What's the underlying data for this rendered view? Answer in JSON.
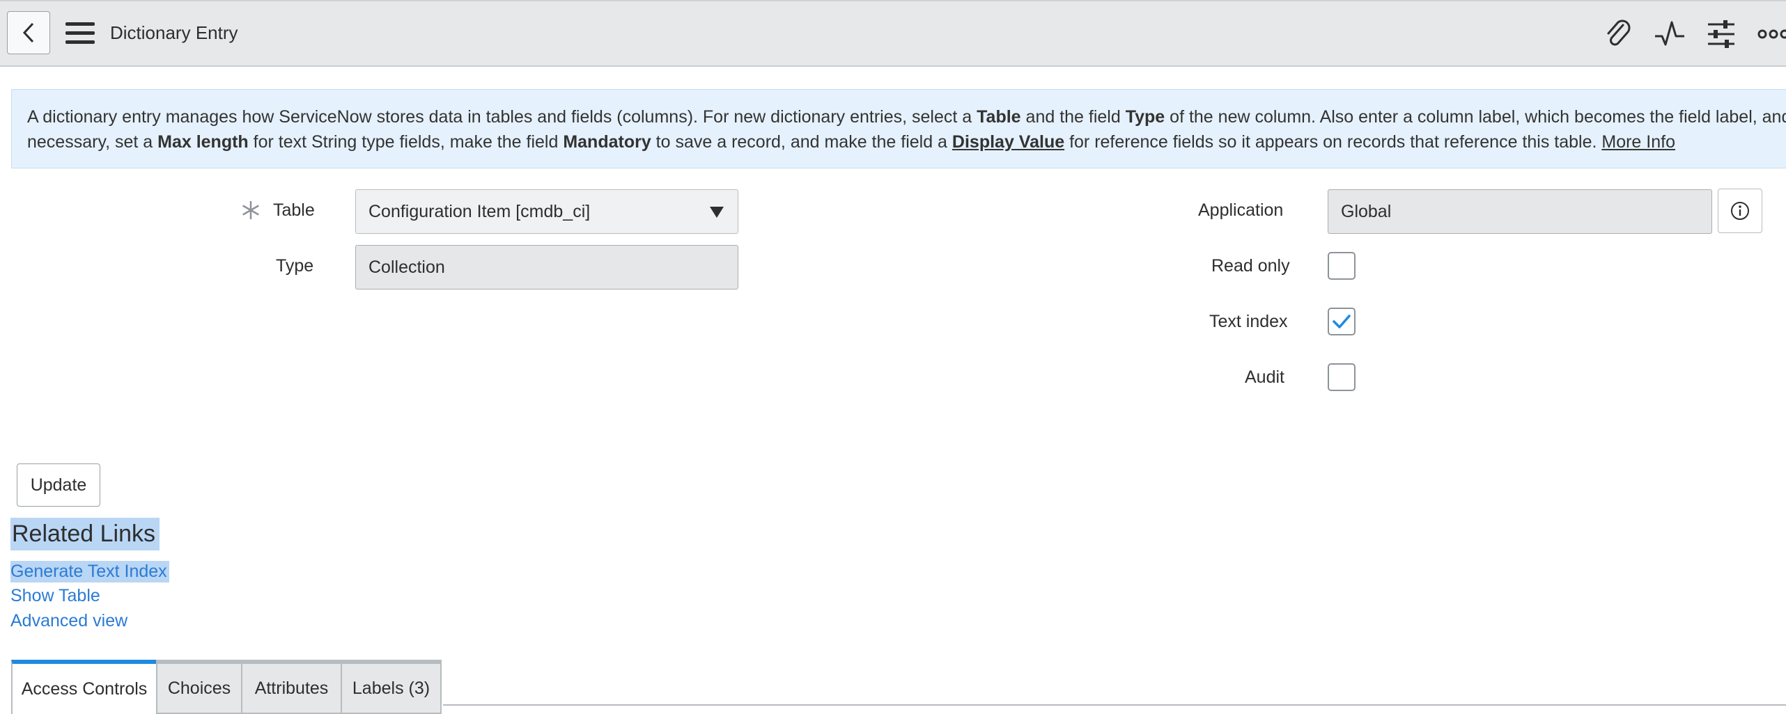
{
  "header": {
    "title": "Dictionary Entry",
    "icons": [
      "back-icon",
      "hamburger-menu-icon",
      "paperclip-icon",
      "activity-icon",
      "settings-sliders-icon",
      "more-icon"
    ]
  },
  "banner": {
    "p1": "A dictionary entry manages how ServiceNow stores data in tables and fields (columns). For new dictionary entries, select a ",
    "table": "Table",
    "p2": " and the field ",
    "type": "Type",
    "p3": " of the new column. Also enter a column label, which becomes the field label, and the co",
    "p4": "necessary, set a ",
    "max_length": "Max length",
    "p5": " for text String type fields, make the field ",
    "mandatory": "Mandatory",
    "p6": " to save a record, and make the field a ",
    "display_value": "Display Value",
    "p7": " for reference fields so it appears on records that reference this table. ",
    "more_info": "More Info"
  },
  "form": {
    "table_label": "Table",
    "table_value": "Configuration Item [cmdb_ci]",
    "type_label": "Type",
    "type_value": "Collection",
    "application_label": "Application",
    "application_value": "Global",
    "read_only_label": "Read only",
    "read_only_checked": false,
    "text_index_label": "Text index",
    "text_index_checked": true,
    "audit_label": "Audit",
    "audit_checked": false
  },
  "actions": {
    "update_label": "Update"
  },
  "related_links": {
    "title": "Related Links",
    "links": [
      "Generate Text Index",
      "Show Table",
      "Advanced view"
    ]
  },
  "tabs": [
    "Access Controls",
    "Choices",
    "Attributes",
    "Labels (3)"
  ],
  "colors": {
    "accent": "#1f8ae0",
    "link": "#2b7bd4",
    "banner_bg": "#e5f1fc",
    "selection": "#b9d6f5"
  }
}
